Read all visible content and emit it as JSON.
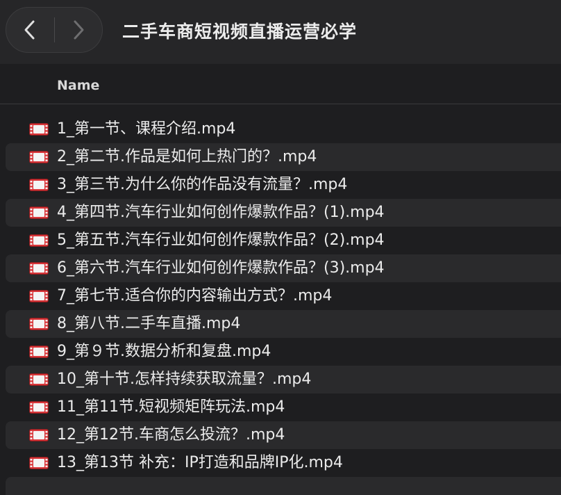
{
  "window": {
    "title": "二手车商短视频直播运营必学"
  },
  "columns": {
    "name": "Name"
  },
  "files": [
    {
      "name": "1_第一节、课程介绍.mp4",
      "icon": "video-file-icon"
    },
    {
      "name": "2_第二节.作品是如何上热门的？.mp4",
      "icon": "video-file-icon"
    },
    {
      "name": "3_第三节.为什么你的作品没有流量？.mp4",
      "icon": "video-file-icon"
    },
    {
      "name": "4_第四节.汽车行业如何创作爆款作品？(1).mp4",
      "icon": "video-file-icon"
    },
    {
      "name": "5_第五节.汽车行业如何创作爆款作品？(2).mp4",
      "icon": "video-file-icon"
    },
    {
      "name": "6_第六节.汽车行业如何创作爆款作品？(3).mp4",
      "icon": "video-file-icon"
    },
    {
      "name": "7_第七节.适合你的内容输出方式？.mp4",
      "icon": "video-file-icon"
    },
    {
      "name": "8_第八节.二手车直播.mp4",
      "icon": "video-file-icon"
    },
    {
      "name": "9_第９节.数据分析和复盘.mp4",
      "icon": "video-file-icon"
    },
    {
      "name": "10_第十节.怎样持续获取流量？.mp4",
      "icon": "video-file-icon"
    },
    {
      "name": "11_第11节.短视频矩阵玩法.mp4",
      "icon": "video-file-icon"
    },
    {
      "name": "12_第12节.车商怎么投流？.mp4",
      "icon": "video-file-icon"
    },
    {
      "name": "13_第13节 补充：IP打造和品牌IP化.mp4",
      "icon": "video-file-icon"
    }
  ],
  "colors": {
    "background": "#1e1e20",
    "toolbar": "#262628",
    "row_alt": "#2a2a2c",
    "icon_red": "#d9363a"
  }
}
